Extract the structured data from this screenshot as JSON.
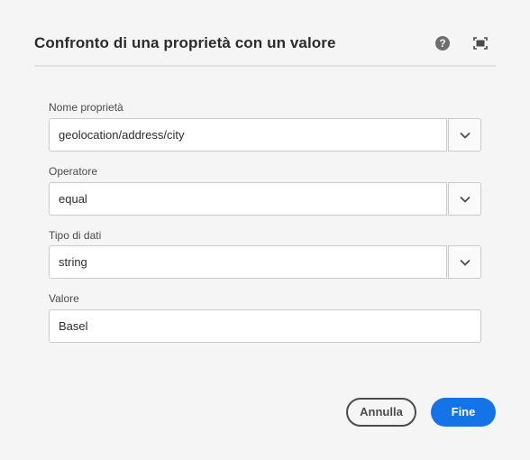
{
  "dialog": {
    "title": "Confronto di una proprietà con un valore",
    "help_glyph": "?",
    "help_icon": "help-icon",
    "fullscreen_icon": "fullscreen-icon"
  },
  "fields": {
    "property_name": {
      "label": "Nome proprietà",
      "value": "geolocation/address/city"
    },
    "operator": {
      "label": "Operatore",
      "value": "equal"
    },
    "data_type": {
      "label": "Tipo di dati",
      "value": "string"
    },
    "value": {
      "label": "Valore",
      "value": "Basel"
    }
  },
  "buttons": {
    "cancel_label": "Annulla",
    "done_label": "Fine"
  },
  "colors": {
    "accent": "#1473e6",
    "background": "#f5f5f5"
  }
}
